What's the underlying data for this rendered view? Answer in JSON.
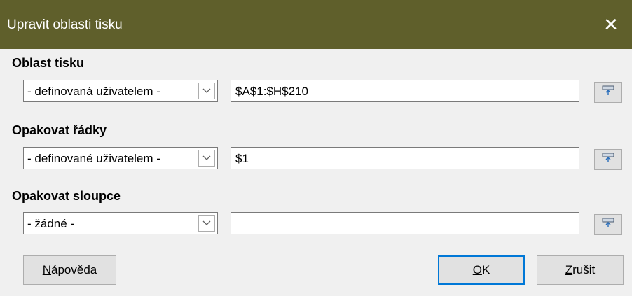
{
  "dialog": {
    "title": "Upravit oblasti tisku",
    "close_glyph": "✕"
  },
  "sections": [
    {
      "label": "Oblast tisku",
      "combo_value": "- definovaná uživatelem -",
      "field_value": "$A$1:$H$210"
    },
    {
      "label": "Opakovat řádky",
      "combo_value": "- definované uživatelem -",
      "field_value": "$1"
    },
    {
      "label": "Opakovat sloupce",
      "combo_value": "- žádné -",
      "field_value": ""
    }
  ],
  "buttons": {
    "help": {
      "mnemonic": "N",
      "rest": "ápověda"
    },
    "ok": {
      "mnemonic": "O",
      "rest": "K"
    },
    "cancel": {
      "mnemonic": "Z",
      "rest": "rušit"
    }
  },
  "icons": {
    "combo_arrow": "chevron-down-icon",
    "shrink": "shrink-dialog-icon"
  }
}
